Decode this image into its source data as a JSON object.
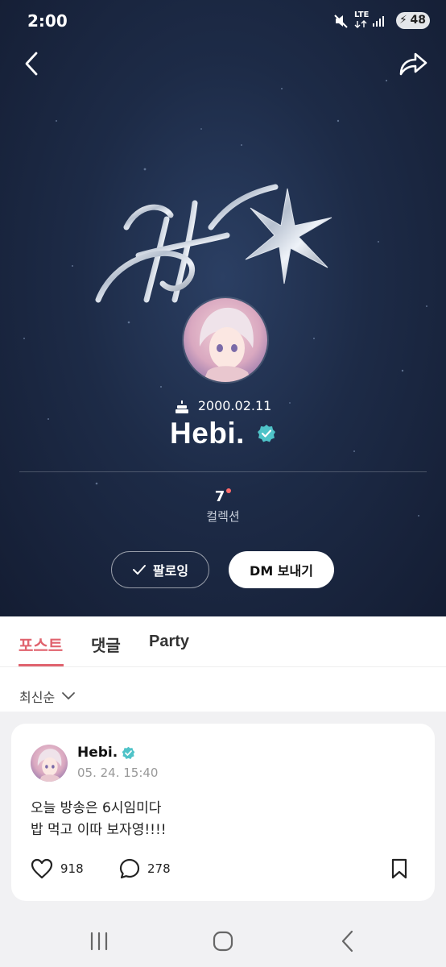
{
  "status_bar": {
    "time": "2:00",
    "network": "LTE",
    "battery": "48",
    "icons": [
      "mute-icon",
      "lte-icon",
      "signal-icon",
      "battery-icon"
    ]
  },
  "header": {
    "back_icon": "chevron-left-icon",
    "share_icon": "share-arrow-icon"
  },
  "profile": {
    "birthday": "2000.02.11",
    "name": "Hebi.",
    "verified": true,
    "collection_count": "7",
    "collection_label": "컬렉션",
    "follow_label": "팔로잉",
    "dm_label": "DM 보내기"
  },
  "tabs": [
    {
      "label": "포스트",
      "active": true
    },
    {
      "label": "댓글",
      "active": false
    },
    {
      "label": "Party",
      "active": false
    }
  ],
  "sort": {
    "label": "최신순"
  },
  "post": {
    "author": "Hebi.",
    "time": "05. 24. 15:40",
    "body": "오늘 방송은 6시임미다\n밥 먹고 이따 보자영!!!!",
    "likes": "918",
    "comments": "278"
  },
  "colors": {
    "accent": "#e0636e",
    "verified": "#4fc3c8",
    "hero_bg": "#1d2b47"
  }
}
